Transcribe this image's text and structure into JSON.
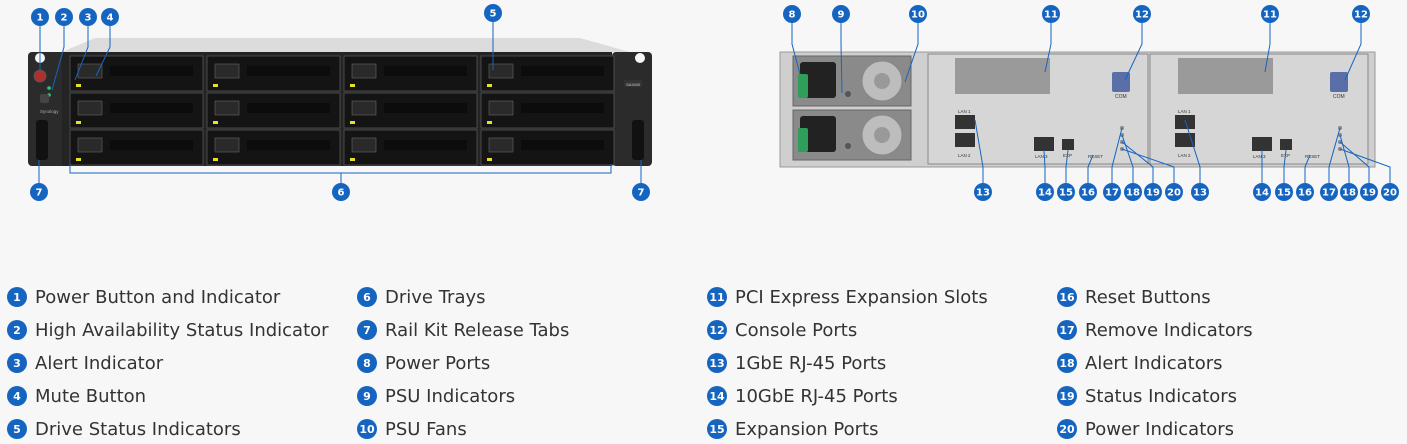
{
  "colors": {
    "badge": "#1565c0",
    "badge_text": "#ffffff",
    "chassis": "#2a2a2a",
    "chassis_top": "#d8d8d8",
    "tray": "#1a1a1a",
    "rear_body": "#c9c9c9",
    "psu_plug": "#2e9e5a"
  },
  "front_panel": {
    "model_label": "SA3400",
    "brand_label": "Synology"
  },
  "rear_labels": {
    "lan1": "LAN 1",
    "lan2": "LAN 2",
    "lan3": "LAN 3",
    "exp": "EXP",
    "reset": "RESET",
    "com": "COM"
  },
  "callouts": {
    "c1": "1",
    "c2": "2",
    "c3": "3",
    "c4": "4",
    "c5": "5",
    "c6": "6",
    "c7a": "7",
    "c7b": "7",
    "c8": "8",
    "c9": "9",
    "c10": "10",
    "c11a": "11",
    "c12a": "12",
    "c11b": "11",
    "c12b": "12",
    "c13a": "13",
    "c14a": "14",
    "c15a": "15",
    "c16a": "16",
    "c17a": "17",
    "c18a": "18",
    "c19a": "19",
    "c20a": "20",
    "c13b": "13",
    "c14b": "14",
    "c15b": "15",
    "c16b": "16",
    "c17b": "17",
    "c18b": "18",
    "c19b": "19",
    "c20b": "20"
  },
  "legend": [
    {
      "num": "1",
      "label": "Power Button and Indicator"
    },
    {
      "num": "2",
      "label": "High Availability Status Indicator"
    },
    {
      "num": "3",
      "label": "Alert Indicator"
    },
    {
      "num": "4",
      "label": "Mute Button"
    },
    {
      "num": "5",
      "label": "Drive Status Indicators"
    },
    {
      "num": "6",
      "label": "Drive Trays"
    },
    {
      "num": "7",
      "label": "Rail Kit Release Tabs"
    },
    {
      "num": "8",
      "label": "Power Ports"
    },
    {
      "num": "9",
      "label": "PSU Indicators"
    },
    {
      "num": "10",
      "label": "PSU Fans"
    },
    {
      "num": "11",
      "label": "PCI Express Expansion Slots"
    },
    {
      "num": "12",
      "label": "Console Ports"
    },
    {
      "num": "13",
      "label": "1GbE RJ-45 Ports"
    },
    {
      "num": "14",
      "label": "10GbE RJ-45 Ports"
    },
    {
      "num": "15",
      "label": "Expansion Ports"
    },
    {
      "num": "16",
      "label": "Reset Buttons"
    },
    {
      "num": "17",
      "label": "Remove Indicators"
    },
    {
      "num": "18",
      "label": "Alert Indicators"
    },
    {
      "num": "19",
      "label": "Status Indicators"
    },
    {
      "num": "20",
      "label": "Power Indicators"
    }
  ]
}
